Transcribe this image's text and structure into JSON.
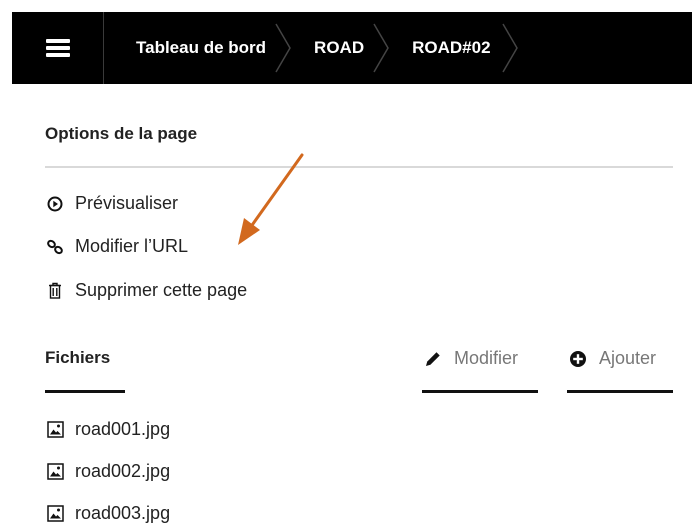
{
  "topbar": {
    "breadcrumbs": [
      "Tableau de bord",
      "ROAD",
      "ROAD#02"
    ]
  },
  "page_options": {
    "title": "Options de la page",
    "items": [
      {
        "label": "Prévisualiser",
        "icon": "play-circle-icon"
      },
      {
        "label": "Modifier l’URL",
        "icon": "link-icon"
      },
      {
        "label": "Supprimer cette page",
        "icon": "trash-icon"
      }
    ]
  },
  "files": {
    "title": "Fichiers",
    "edit_label": "Modifier",
    "add_label": "Ajouter",
    "items": [
      "road001.jpg",
      "road002.jpg",
      "road003.jpg"
    ]
  },
  "annotation": {
    "color": "#d2691e"
  }
}
